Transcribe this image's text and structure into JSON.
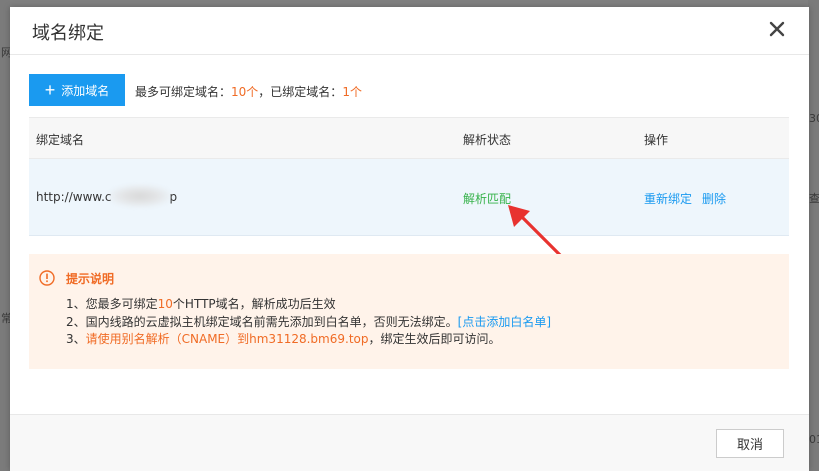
{
  "background": {
    "left_frags": [
      "网",
      "常"
    ],
    "right_frags": [
      "30",
      "查",
      "01"
    ]
  },
  "modal": {
    "title": "域名绑定"
  },
  "toolbar": {
    "add_label": "添加域名",
    "limit_prefix": "最多可绑定域名：",
    "limit_value": "10个",
    "bound_prefix": "，已绑定域名：",
    "bound_value": "1个"
  },
  "table": {
    "headers": [
      "绑定域名",
      "解析状态",
      "操作"
    ],
    "rows": [
      {
        "domain": "http://www.c",
        "domain_tail": "p",
        "status": "解析匹配",
        "actions": [
          "重新绑定",
          "删除"
        ]
      }
    ]
  },
  "tips": {
    "title": "提示说明",
    "line1_a": "1、您最多可绑定",
    "line1_b": "10",
    "line1_c": "个HTTP域名，解析成功后生效",
    "line2_a": "2、国内线路的云虚拟主机绑定域名前需先添加到白名单，否则无法绑定。",
    "line2_link": "[点击添加白名单]",
    "line3_a": "3、",
    "line3_b": "请使用别名解析（CNAME）到hm31128.bm69.top",
    "line3_c": "，绑定生效后即可访问。"
  },
  "footer": {
    "cancel_label": "取消"
  },
  "colors": {
    "primary": "#1a9af0",
    "accent_orange": "#f06b25",
    "success_green": "#36b24a",
    "annotation_red": "#e8322f"
  }
}
